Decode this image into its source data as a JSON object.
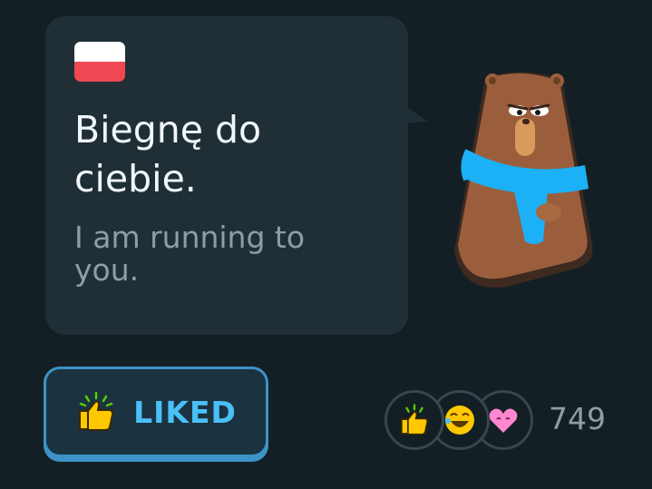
{
  "card": {
    "flag": "poland-flag",
    "sentence": "Biegnę do ciebie.",
    "translation": "I am running to you."
  },
  "character": {
    "icon": "bear-with-scarf-illustration"
  },
  "like_button": {
    "label": "LIKED",
    "icon": "thumbs-up-icon"
  },
  "reactions": {
    "icons": [
      "thumbs-up-icon",
      "laughing-emoji-icon",
      "heart-eyes-emoji-icon"
    ],
    "count": "749"
  },
  "colors": {
    "background": "#131f24",
    "card": "#202f36",
    "accent_blue": "#49c0f8",
    "button_border": "#3c93c7",
    "scarf": "#1cb0f6",
    "bear_fur": "#9b5e3c",
    "thumb_yellow": "#ffc800"
  }
}
